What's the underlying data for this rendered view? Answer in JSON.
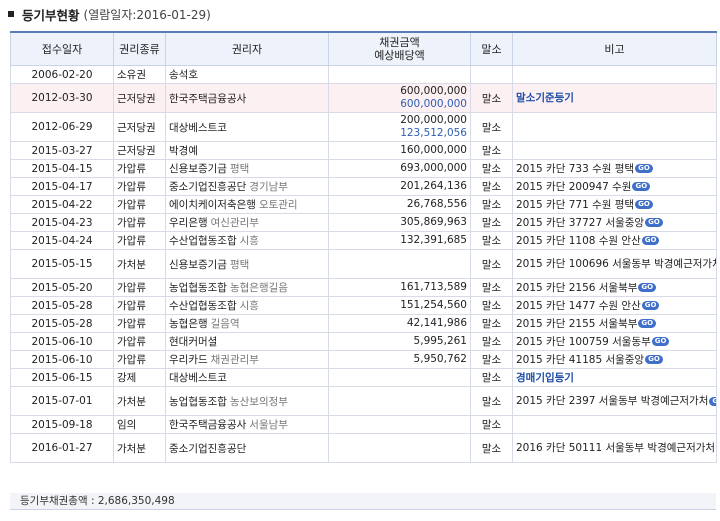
{
  "header": {
    "title": "등기부현황",
    "date": "(열람일자:2016-01-29)"
  },
  "columns": {
    "date": "접수일자",
    "kind": "권리종류",
    "holder": "권리자",
    "amount_line1": "채권금액",
    "amount_line2": "예상배당액",
    "erase": "말소",
    "note": "비고"
  },
  "rows": [
    {
      "date": "2006-02-20",
      "kind": "소유권",
      "holder": "송석호",
      "sub": "",
      "amount": "",
      "amount2": "",
      "erase": "",
      "note": "",
      "note_kind": "none"
    },
    {
      "date": "2012-03-30",
      "kind": "근저당권",
      "holder": "한국주택금융공사",
      "sub": "",
      "amount": "600,000,000",
      "amount2": "600,000,000",
      "erase": "말소",
      "note": "말소기준등기",
      "note_kind": "link"
    },
    {
      "date": "2012-06-29",
      "kind": "근저당권",
      "holder": "대상베스트코",
      "sub": "",
      "amount": "200,000,000",
      "amount2": "123,512,056",
      "erase": "말소",
      "note": "",
      "note_kind": "none"
    },
    {
      "date": "2015-03-27",
      "kind": "근저당권",
      "holder": "박경예",
      "sub": "",
      "amount": "160,000,000",
      "amount2": "",
      "erase": "말소",
      "note": "",
      "note_kind": "none"
    },
    {
      "date": "2015-04-15",
      "kind": "가압류",
      "holder": "신용보증기금",
      "sub": "평택",
      "amount": "693,000,000",
      "amount2": "",
      "erase": "말소",
      "note": "2015 카단 733 수원 평택",
      "note_kind": "go"
    },
    {
      "date": "2015-04-17",
      "kind": "가압류",
      "holder": "중소기업진흥공단",
      "sub": "경기남부",
      "amount": "201,264,136",
      "amount2": "",
      "erase": "말소",
      "note": "2015 카단 200947 수원",
      "note_kind": "go"
    },
    {
      "date": "2015-04-22",
      "kind": "가압류",
      "holder": "에이치케이저축은행",
      "sub": "오토관리",
      "amount": "26,768,556",
      "amount2": "",
      "erase": "말소",
      "note": "2015 카단 771 수원 평택",
      "note_kind": "go"
    },
    {
      "date": "2015-04-23",
      "kind": "가압류",
      "holder": "우리은행",
      "sub": "여신관리부",
      "amount": "305,869,963",
      "amount2": "",
      "erase": "말소",
      "note": "2015 카단 37727 서울중앙",
      "note_kind": "go"
    },
    {
      "date": "2015-04-24",
      "kind": "가압류",
      "holder": "수산업협동조합",
      "sub": "시흥",
      "amount": "132,391,685",
      "amount2": "",
      "erase": "말소",
      "note": "2015 카단 1108 수원 안산",
      "note_kind": "go"
    },
    {
      "date": "2015-05-15",
      "kind": "가처분",
      "holder": "신용보증기금",
      "sub": "평택",
      "amount": "",
      "amount2": "",
      "erase": "말소",
      "note": "2015 카단 100696 서울동부 박경예근저가처",
      "note_kind": "go"
    },
    {
      "date": "2015-05-20",
      "kind": "가압류",
      "holder": "농업협동조합",
      "sub": "농협은행길음",
      "amount": "161,713,589",
      "amount2": "",
      "erase": "말소",
      "note": "2015 카단 2156 서울북부",
      "note_kind": "go"
    },
    {
      "date": "2015-05-28",
      "kind": "가압류",
      "holder": "수산업협동조합",
      "sub": "시흥",
      "amount": "151,254,560",
      "amount2": "",
      "erase": "말소",
      "note": "2015 카단 1477 수원 안산",
      "note_kind": "go"
    },
    {
      "date": "2015-05-28",
      "kind": "가압류",
      "holder": "농협은행",
      "sub": "길음역",
      "amount": "42,141,986",
      "amount2": "",
      "erase": "말소",
      "note": "2015 카단 2155 서울북부",
      "note_kind": "go"
    },
    {
      "date": "2015-06-10",
      "kind": "가압류",
      "holder": "현대커머셜",
      "sub": "",
      "amount": "5,995,261",
      "amount2": "",
      "erase": "말소",
      "note": "2015 카단 100759 서울동부",
      "note_kind": "go"
    },
    {
      "date": "2015-06-10",
      "kind": "가압류",
      "holder": "우리카드",
      "sub": "채권관리부",
      "amount": "5,950,762",
      "amount2": "",
      "erase": "말소",
      "note": "2015 카단 41185 서울중앙",
      "note_kind": "go"
    },
    {
      "date": "2015-06-15",
      "kind": "강제",
      "holder": "대상베스트코",
      "sub": "",
      "amount": "",
      "amount2": "",
      "erase": "말소",
      "note": "경매기입등기",
      "note_kind": "link"
    },
    {
      "date": "2015-07-01",
      "kind": "가처분",
      "holder": "농업협동조합",
      "sub": "농산보의정부",
      "amount": "",
      "amount2": "",
      "erase": "말소",
      "note": "2015 카단 2397 서울동부 박경예근저가처",
      "note_kind": "go"
    },
    {
      "date": "2015-09-18",
      "kind": "임의",
      "holder": "한국주택금융공사",
      "sub": "서울남부",
      "amount": "",
      "amount2": "",
      "erase": "말소",
      "note": "",
      "note_kind": "none"
    },
    {
      "date": "2016-01-27",
      "kind": "가처분",
      "holder": "중소기업진흥공단",
      "sub": "",
      "amount": "",
      "amount2": "",
      "erase": "말소",
      "note": "2016 카단 50111 서울동부 박경예근저가처",
      "note_kind": "go"
    }
  ],
  "footer": {
    "label": "등기부채권총액",
    "value": "2,686,350,498"
  },
  "go_label": "GO",
  "colors": {
    "header_bg": "#eef2fa",
    "highlight_bg": "#fdf0f2",
    "link": "#1f4ea8",
    "go_badge": "#3f6fc9"
  }
}
